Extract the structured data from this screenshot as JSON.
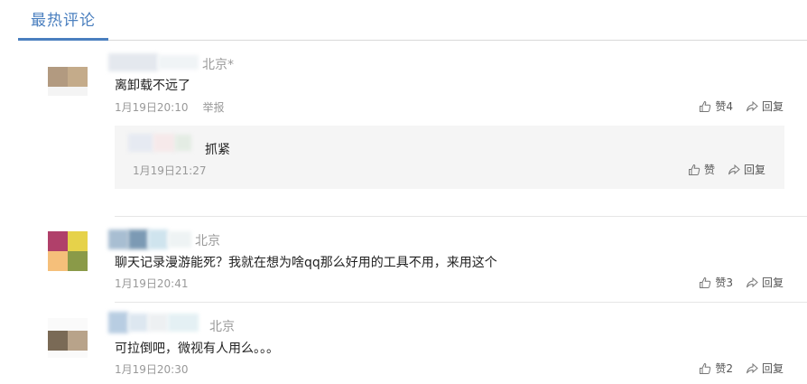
{
  "header": {
    "title": "最热评论"
  },
  "comments": [
    {
      "location": "北京*",
      "text": "离卸载不远了",
      "time": "1月19日20:10",
      "report": "举报",
      "like_label": "赞4",
      "reply_label": "回复",
      "replies": [
        {
          "text": "抓紧",
          "time": "1月19日21:27",
          "like_label": "赞",
          "reply_label": "回复"
        }
      ]
    },
    {
      "location": "北京",
      "text": "聊天记录漫游能死？我就在想为啥qq那么好用的工具不用，来用这个",
      "time": "1月19日20:41",
      "like_label": "赞3",
      "reply_label": "回复"
    },
    {
      "location": "北京",
      "text": "可拉倒吧，微视有人用么。。。",
      "time": "1月19日20:30",
      "like_label": "赞2",
      "reply_label": "回复"
    }
  ],
  "icons": {
    "like": "thumbs-up-icon",
    "reply": "share-arrow-icon"
  },
  "colors": {
    "accent": "#4a7fbf"
  }
}
